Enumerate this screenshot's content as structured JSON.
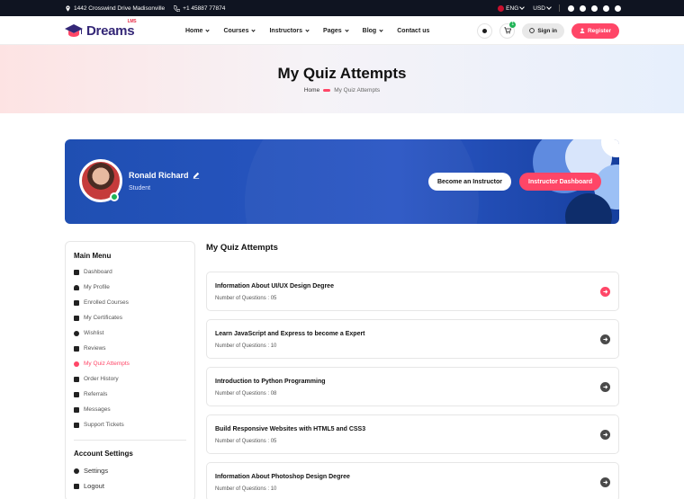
{
  "topbar": {
    "address": "1442 Crosswind Drive Madisonville",
    "phone": "+1 45887 77874",
    "language": "ENG",
    "currency": "USD",
    "social_icons": [
      "facebook-icon",
      "instagram-icon",
      "behance-icon",
      "twitter-icon",
      "youtube-icon"
    ]
  },
  "header": {
    "logo_text": "Dreams",
    "logo_sup": "LMS",
    "nav": [
      "Home",
      "Courses",
      "Instructors",
      "Pages",
      "Blog",
      "Contact us"
    ],
    "cart_count": "1",
    "signin_label": "Sign in",
    "register_label": "Register"
  },
  "banner": {
    "title": "My Quiz Attempts",
    "breadcrumb_home": "Home",
    "breadcrumb_current": "My Quiz Attempts"
  },
  "profile": {
    "name": "Ronald Richard",
    "role": "Student",
    "become_instructor_label": "Become an Instructor",
    "instructor_dashboard_label": "Instructor Dashboard"
  },
  "sidebar": {
    "main_menu_title": "Main Menu",
    "items": [
      {
        "label": "Dashboard",
        "icon": "grid-icon"
      },
      {
        "label": "My Profile",
        "icon": "user-icon"
      },
      {
        "label": "Enrolled Courses",
        "icon": "graduation-cap-icon"
      },
      {
        "label": "My Certificates",
        "icon": "certificate-icon"
      },
      {
        "label": "Wishlist",
        "icon": "heart-icon"
      },
      {
        "label": "Reviews",
        "icon": "star-icon"
      },
      {
        "label": "My Quiz Attempts",
        "icon": "quiz-icon",
        "active": true
      },
      {
        "label": "Order History",
        "icon": "receipt-icon"
      },
      {
        "label": "Referrals",
        "icon": "referral-icon"
      },
      {
        "label": "Messages",
        "icon": "message-icon"
      },
      {
        "label": "Support Tickets",
        "icon": "ticket-icon"
      }
    ],
    "account_title": "Account Settings",
    "account_items": [
      {
        "label": "Settings",
        "icon": "gear-icon"
      },
      {
        "label": "Logout",
        "icon": "logout-icon"
      }
    ]
  },
  "main": {
    "title": "My Quiz Attempts",
    "quizzes": [
      {
        "title": "Information About UI/UX Design Degree",
        "count": "Number of Questions : 05",
        "highlight": true
      },
      {
        "title": "Learn JavaScript and Express to become a Expert",
        "count": "Number of Questions : 10"
      },
      {
        "title": "Introduction to Python Programming",
        "count": "Number of Questions : 08"
      },
      {
        "title": "Build Responsive Websites with HTML5 and CSS3",
        "count": "Number of Questions : 05"
      },
      {
        "title": "Information About Photoshop Design Degree",
        "count": "Number of Questions : 10"
      }
    ]
  },
  "colors": {
    "accent": "#ff4667",
    "brand": "#342777",
    "card_blue": "#2a56c4",
    "topbar": "#0f1421"
  }
}
